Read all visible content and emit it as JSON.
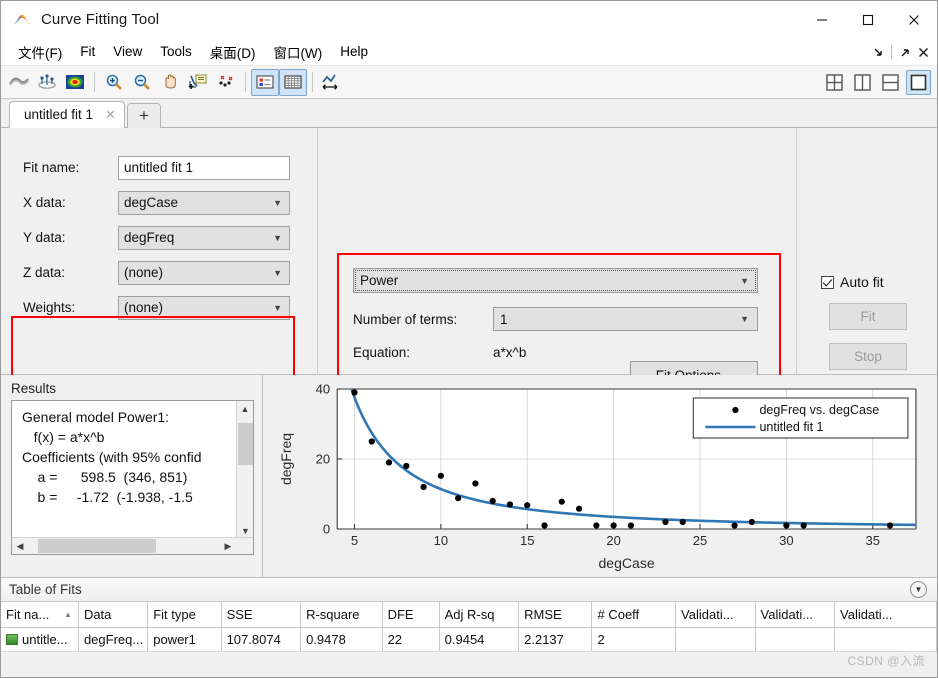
{
  "window": {
    "title": "Curve Fitting Tool",
    "minimize": "—",
    "maximize": "☐",
    "close": "✕"
  },
  "menubar": {
    "items": [
      {
        "label": "文件(F)",
        "mnemonic": "F"
      },
      {
        "label": "Fit",
        "mnemonic": "i"
      },
      {
        "label": "View",
        "mnemonic": "V"
      },
      {
        "label": "Tools",
        "mnemonic": "T"
      },
      {
        "label": "桌面(D)",
        "mnemonic": "D"
      },
      {
        "label": "窗口(W)",
        "mnemonic": "W"
      },
      {
        "label": "Help",
        "mnemonic": "H"
      }
    ],
    "right_icons": [
      "dock-down-icon",
      "undock-icon",
      "close-icon"
    ]
  },
  "toolbar": {
    "buttons": [
      {
        "name": "curve-fit-icon",
        "tip": "Curve fit"
      },
      {
        "name": "surface-fit-icon",
        "tip": "Surface fit"
      },
      {
        "name": "colormap-icon",
        "tip": "Colormap"
      },
      {
        "name": "zoom-in-icon",
        "tip": "Zoom In"
      },
      {
        "name": "zoom-out-icon",
        "tip": "Zoom Out"
      },
      {
        "name": "pan-icon",
        "tip": "Pan"
      },
      {
        "name": "data-cursor-icon",
        "tip": "Data Cursor"
      },
      {
        "name": "exclude-outliers-icon",
        "tip": "Exclude outliers"
      },
      {
        "name": "legend-icon",
        "tip": "Legend",
        "active": true
      },
      {
        "name": "grid-icon",
        "tip": "Grid",
        "active": true
      },
      {
        "name": "axes-limits-icon",
        "tip": "Axes limits"
      }
    ],
    "layouts": [
      {
        "name": "layout-quad-icon",
        "selected": false
      },
      {
        "name": "layout-vertical-split-icon",
        "selected": false
      },
      {
        "name": "layout-horizontal-split-icon",
        "selected": false
      },
      {
        "name": "layout-single-icon",
        "selected": true
      }
    ]
  },
  "tabs": {
    "items": [
      {
        "label": "untitled fit 1",
        "close": "✕",
        "active": true
      }
    ],
    "add_label": "+"
  },
  "fit_setup": {
    "fit_name_label": "Fit name:",
    "fit_name_value": "untitled fit 1",
    "x_data_label": "X data:",
    "x_data_value": "degCase",
    "y_data_label": "Y data:",
    "y_data_value": "degFreq",
    "z_data_label": "Z data:",
    "z_data_value": "(none)",
    "weights_label": "Weights:",
    "weights_value": "(none)",
    "fit_type_value": "Power",
    "num_terms_label": "Number of terms:",
    "num_terms_value": "1",
    "equation_label": "Equation:",
    "equation_value": "a*x^b",
    "fit_options_label": "Fit Options...",
    "auto_fit_label": "Auto fit",
    "auto_fit_checked": true,
    "fit_button_label": "Fit",
    "stop_button_label": "Stop"
  },
  "results": {
    "title": "Results",
    "text": "General model Power1:\n   f(x) = a*x^b\nCoefficients (with 95% confid\n    a =      598.5  (346, 851)\n    b =     -1.72  (-1.938, -1.5"
  },
  "chart_data": {
    "type": "scatter",
    "title": "",
    "xlabel": "degCase",
    "ylabel": "degFreq",
    "xlim": [
      4.0,
      37.5
    ],
    "ylim": [
      0,
      40
    ],
    "xticks": [
      5,
      10,
      15,
      20,
      25,
      30,
      35
    ],
    "yticks": [
      0,
      20,
      40
    ],
    "grid": true,
    "legend_position": "top-right",
    "series": [
      {
        "name": "degFreq vs. degCase",
        "type": "scatter",
        "marker": "circle",
        "color": "#000000",
        "x": [
          5,
          6,
          7,
          8,
          9,
          10,
          11,
          12,
          13,
          14,
          15,
          16,
          17,
          18,
          19,
          20,
          21,
          23,
          24,
          27,
          28,
          30,
          31,
          36
        ],
        "y": [
          39,
          25,
          19,
          18,
          12,
          15.2,
          8.8,
          13,
          8,
          7,
          6.8,
          1,
          7.8,
          5.8,
          1,
          1,
          1,
          2,
          2,
          1,
          2,
          1,
          1,
          1
        ]
      },
      {
        "name": "untitled fit 1",
        "type": "line",
        "color": "#3077b5",
        "equation": "a*x^b",
        "a": 598.5,
        "b": -1.72
      }
    ]
  },
  "table_of_fits": {
    "title": "Table of Fits",
    "columns": [
      "Fit na...",
      "Data",
      "Fit type",
      "SSE",
      "R-square",
      "DFE",
      "Adj R-sq",
      "RMSE",
      "# Coeff",
      "Validati...",
      "Validati...",
      "Validati..."
    ],
    "sorted_column_index": 0,
    "sort_arrow": "▲",
    "rows": [
      {
        "cells": [
          "untitle...",
          "degFreq...",
          "power1",
          "107.8074",
          "0.9478",
          "22",
          "0.9454",
          "2.2137",
          "2",
          "",
          "",
          ""
        ],
        "swatch_color": "#45a03a"
      }
    ]
  },
  "watermark": "CSDN @入流"
}
